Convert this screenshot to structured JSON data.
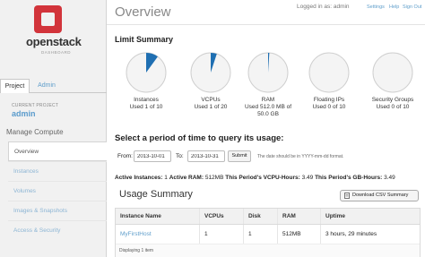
{
  "brand": {
    "name": "openstack",
    "sub": "DASHBOARD",
    "cube_color": "#d2343b"
  },
  "sidebar": {
    "tabs": [
      {
        "label": "Project"
      },
      {
        "label": "Admin"
      }
    ],
    "current_project_label": "CURRENT PROJECT",
    "current_project": "admin",
    "section_title": "Manage Compute",
    "items": [
      {
        "label": "Overview"
      },
      {
        "label": "Instances"
      },
      {
        "label": "Volumes"
      },
      {
        "label": "Images & Snapshots"
      },
      {
        "label": "Access & Security"
      }
    ]
  },
  "header": {
    "title": "Overview",
    "logged_in": "Logged in as: admin",
    "settings": "Settings",
    "help": "Help",
    "sign_out": "Sign Out"
  },
  "limits": {
    "title": "Limit Summary",
    "accent": "#1f6fb2",
    "items": [
      {
        "name": "Instances",
        "detail": "Used 1 of 10",
        "fraction": 0.1
      },
      {
        "name": "VCPUs",
        "detail": "Used 1 of 20",
        "fraction": 0.05
      },
      {
        "name": "RAM",
        "detail": "Used 512.0 MB of 50.0 GB",
        "fraction": 0.01
      },
      {
        "name": "Floating IPs",
        "detail": "Used 0 of 10",
        "fraction": 0
      },
      {
        "name": "Security Groups",
        "detail": "Used 0 of 10",
        "fraction": 0
      }
    ]
  },
  "period": {
    "title": "Select a period of time to query its usage:",
    "from_label": "From:",
    "from_value": "2013-10-01",
    "to_label": "To:",
    "to_value": "2013-10-31",
    "submit": "Submit",
    "hint": "The date should be in YYYY-mm-dd format."
  },
  "active": {
    "instances_label": "Active Instances:",
    "instances": "1",
    "ram_label": "Active RAM:",
    "ram": "512MB",
    "vcpu_label": "This Period's VCPU-Hours:",
    "vcpu": "3.49",
    "gb_label": "This Period's GB-Hours:",
    "gb": "3.49"
  },
  "usage": {
    "title": "Usage Summary",
    "csv_button": "Download CSV Summary",
    "columns": [
      "Instance Name",
      "VCPUs",
      "Disk",
      "RAM",
      "Uptime"
    ],
    "rows": [
      {
        "name": "MyFirstHost",
        "vcpus": "1",
        "disk": "1",
        "ram": "512MB",
        "uptime": "3 hours, 29 minutes"
      }
    ],
    "footer": "Displaying 1 item"
  }
}
